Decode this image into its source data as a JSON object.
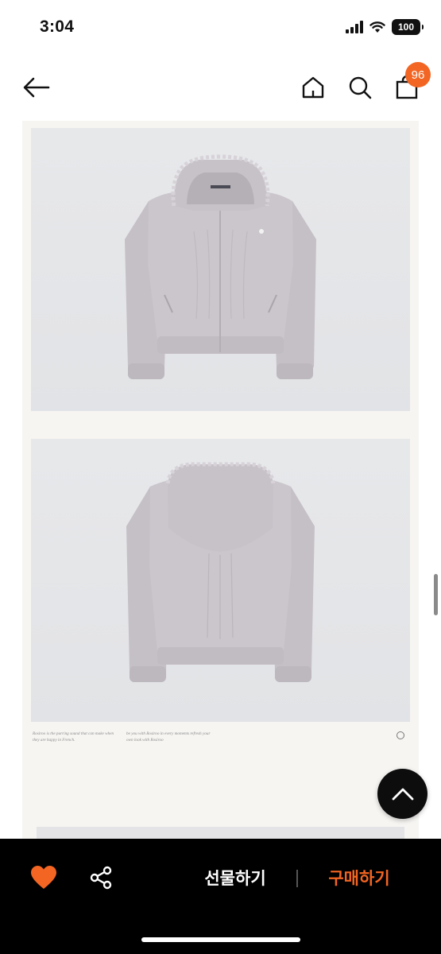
{
  "status_bar": {
    "time": "3:04",
    "battery": "100"
  },
  "header": {
    "cart_count": "96"
  },
  "detail": {
    "caption_left": "Rosiroo is the purring sound that can make when they are happy in French.",
    "caption_right": "be you with Rosiroo in every moments refresh your own look with Rosiroo"
  },
  "bottom_bar": {
    "gift_label": "선물하기",
    "buy_label": "구매하기"
  },
  "colors": {
    "accent": "#f26522",
    "bar_background": "#000000",
    "jacket": "#c9c3ca",
    "photo_background": "#e5e6e8"
  },
  "icons": [
    "back-arrow-icon",
    "home-icon",
    "search-icon",
    "shopping-bag-icon",
    "heart-icon",
    "share-icon",
    "chevron-up-icon",
    "wifi-icon",
    "signal-icon"
  ]
}
